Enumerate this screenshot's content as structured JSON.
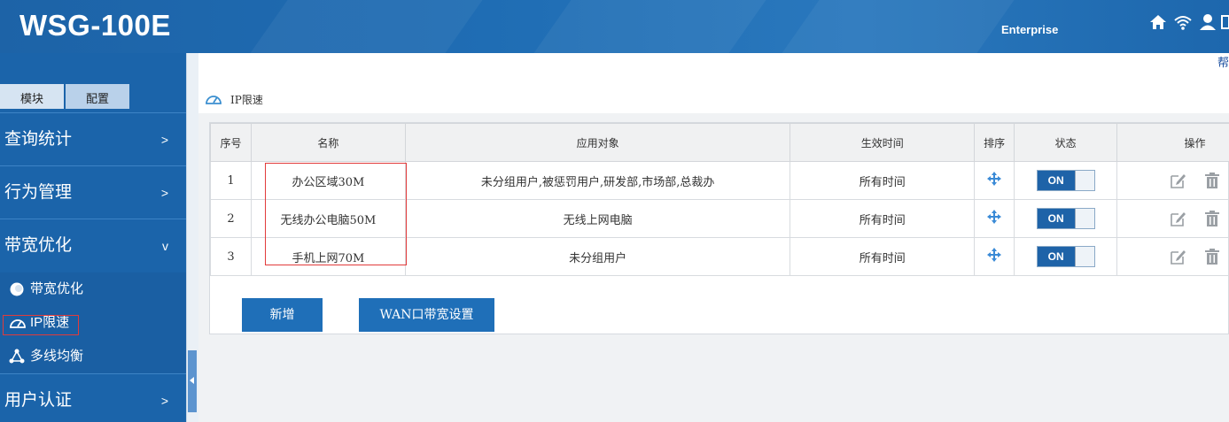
{
  "header": {
    "logo": "WSG-100E",
    "edition": "Enterprise",
    "icons": [
      "home-icon",
      "wifi-icon",
      "user-icon",
      "exit-icon"
    ]
  },
  "sidebar": {
    "tabs": [
      "模块",
      "配置"
    ],
    "menus": [
      {
        "label": "查询统计",
        "arrow": ">"
      },
      {
        "label": "行为管理",
        "arrow": ">"
      },
      {
        "label": "带宽优化",
        "arrow": "v"
      },
      {
        "label": "用户认证",
        "arrow": ">"
      }
    ],
    "subitems": [
      {
        "label": "带宽优化",
        "icon": "circle-icon"
      },
      {
        "label": "IP限速",
        "icon": "gauge-icon"
      },
      {
        "label": "多线均衡",
        "icon": "network-icon"
      }
    ]
  },
  "content": {
    "help": "帮",
    "title": "IP限速",
    "columns": [
      "序号",
      "名称",
      "应用对象",
      "生效时间",
      "排序",
      "状态",
      "操作"
    ],
    "rows": [
      {
        "index": "1",
        "name": "办公区域30M",
        "target": "未分组用户,被惩罚用户,研发部,市场部,总裁办",
        "time": "所有时间",
        "status": "ON"
      },
      {
        "index": "2",
        "name": "无线办公电脑50M",
        "target": "无线上网电脑",
        "time": "所有时间",
        "status": "ON"
      },
      {
        "index": "3",
        "name": "手机上网70M",
        "target": "未分组用户",
        "time": "所有时间",
        "status": "ON"
      }
    ],
    "buttons": {
      "add": "新增",
      "wan": "WAN口带宽设置"
    }
  },
  "colors": {
    "primary": "#1b64aa",
    "button": "#1f6fb8",
    "highlight": "#e23b3b"
  }
}
